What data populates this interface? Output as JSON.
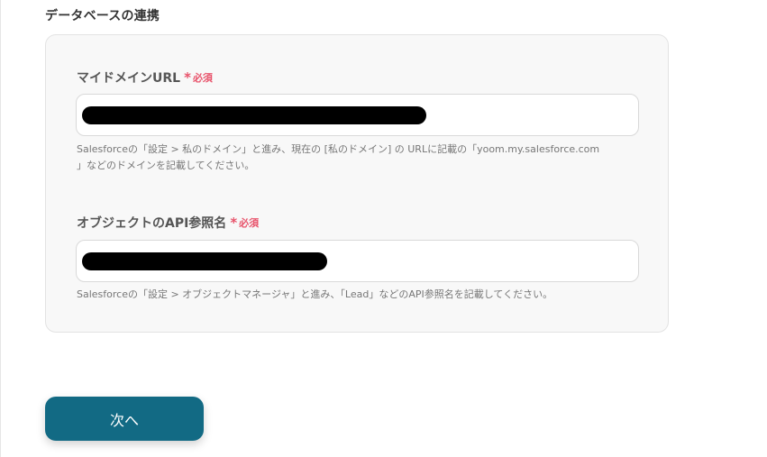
{
  "section": {
    "title": "データベースの連携"
  },
  "fields": [
    {
      "label": "マイドメインURL",
      "required_mark": "*",
      "required_text": "必須",
      "value_redacted": true,
      "help_line1": "Salesforceの「設定 > 私のドメイン」と進み、現在の [私のドメイン] の URLに記載の「yoom.my.salesforce.com",
      "help_line2": "」などのドメインを記載してください。"
    },
    {
      "label": "オブジェクトのAPI参照名",
      "required_mark": "*",
      "required_text": "必須",
      "value_redacted": true,
      "help_line1": "Salesforceの「設定 > オブジェクトマネージャ」と進み、「Lead」などのAPI参照名を記載してください。"
    }
  ],
  "actions": {
    "next_label": "次へ"
  },
  "colors": {
    "accent": "#126a84",
    "required": "#e8536b",
    "card_bg": "#f8f8f8"
  }
}
